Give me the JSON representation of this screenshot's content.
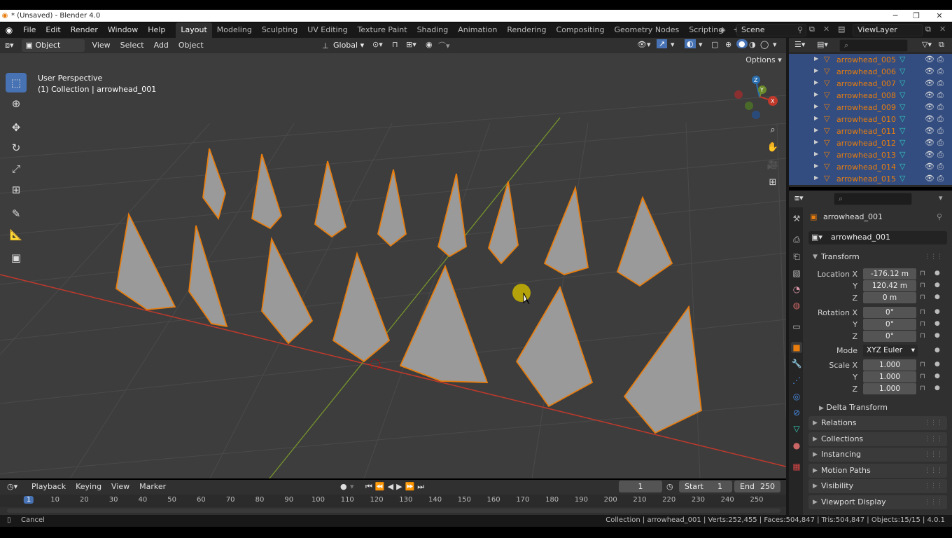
{
  "window": {
    "title": "* (Unsaved) - Blender 4.0",
    "minimize": "─",
    "maximize": "❐",
    "close": "✕"
  },
  "menus": [
    "File",
    "Edit",
    "Render",
    "Window",
    "Help"
  ],
  "workspaces": [
    "Layout",
    "Modeling",
    "Sculpting",
    "UV Editing",
    "Texture Paint",
    "Shading",
    "Animation",
    "Rendering",
    "Compositing",
    "Geometry Nodes",
    "Scripting"
  ],
  "active_workspace": "Layout",
  "scene": "Scene",
  "view_layer": "ViewLayer",
  "viewport_header": {
    "mode": "Object Mode",
    "menus": [
      "View",
      "Select",
      "Add",
      "Object"
    ],
    "orientation": "Global",
    "options": "Options"
  },
  "viewport": {
    "perspective": "User Perspective",
    "collection_info": "(1) Collection | arrowhead_001",
    "axis_x": "X",
    "axis_y": "Y",
    "axis_z": "Z"
  },
  "outliner": {
    "items": [
      "arrowhead_005",
      "arrowhead_006",
      "arrowhead_007",
      "arrowhead_008",
      "arrowhead_009",
      "arrowhead_010",
      "arrowhead_011",
      "arrowhead_012",
      "arrowhead_013",
      "arrowhead_014",
      "arrowhead_015"
    ]
  },
  "properties": {
    "object_name": "arrowhead_001",
    "datablock": "arrowhead_001",
    "transform_title": "Transform",
    "location_label": "Location X",
    "location": {
      "x": "-176.12 m",
      "y": "120.42 m",
      "z": "0 m"
    },
    "rotation_label": "Rotation X",
    "rotation": {
      "x": "0°",
      "y": "0°",
      "z": "0°"
    },
    "mode_label": "Mode",
    "mode": "XYZ Euler",
    "scale_label": "Scale X",
    "scale": {
      "x": "1.000",
      "y": "1.000",
      "z": "1.000"
    },
    "axis_labels": {
      "y": "Y",
      "z": "Z"
    },
    "delta_transform": "Delta Transform",
    "panels": [
      "Relations",
      "Collections",
      "Instancing",
      "Motion Paths",
      "Visibility",
      "Viewport Display"
    ]
  },
  "timeline": {
    "menus": [
      "Playback",
      "Keying",
      "View",
      "Marker"
    ],
    "current_frame": "1",
    "start_label": "Start",
    "start": "1",
    "end_label": "End",
    "end": "250",
    "ticks": [
      "1",
      "10",
      "20",
      "30",
      "40",
      "50",
      "60",
      "70",
      "80",
      "90",
      "100",
      "110",
      "120",
      "130",
      "140",
      "150",
      "160",
      "170",
      "180",
      "190",
      "200",
      "210",
      "220",
      "230",
      "240",
      "250"
    ]
  },
  "status": {
    "left": "Cancel",
    "right": "Collection | arrowhead_001 | Verts:252,455 | Faces:504,847 | Tris:504,847 | Objects:15/15 | 4.0.1"
  },
  "colors": {
    "accent": "#4772b3",
    "selected_outline": "#e87d0d",
    "x_axis": "#c0392b",
    "y_axis": "#7a9a2a"
  }
}
